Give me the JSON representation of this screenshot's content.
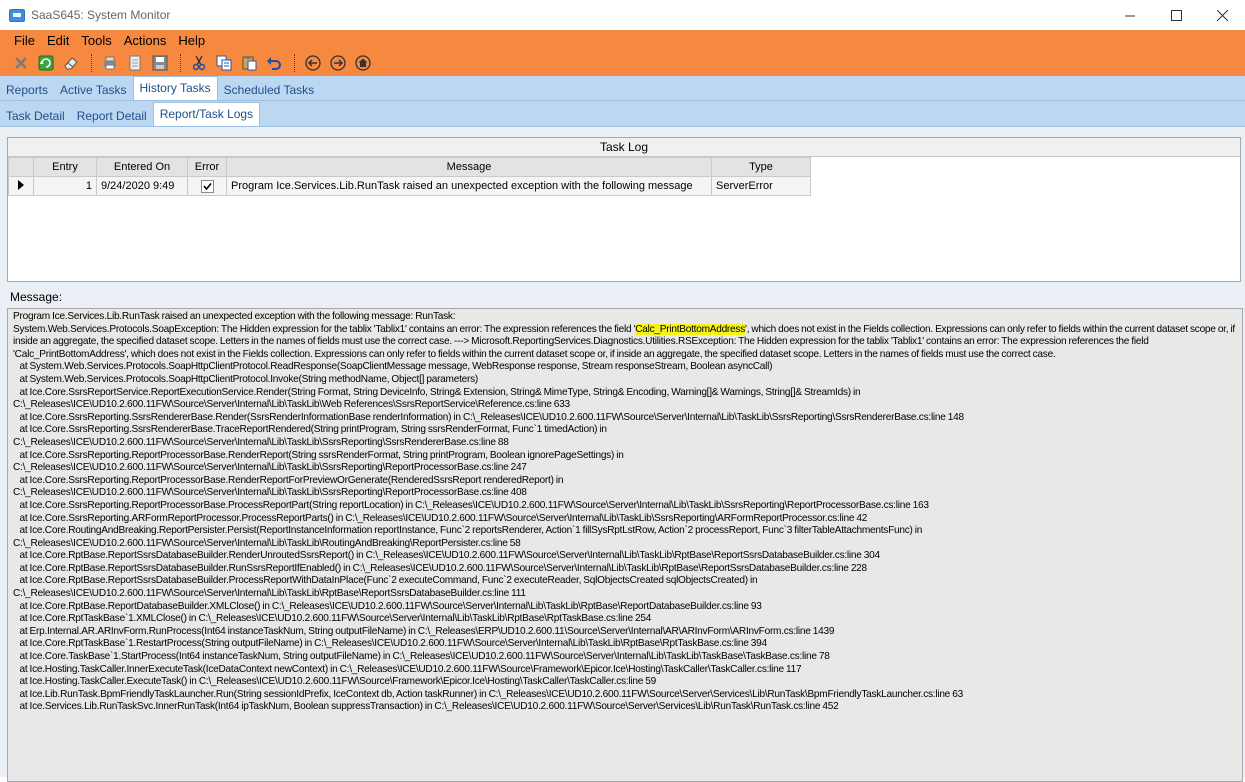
{
  "window": {
    "title": "SaaS645: System Monitor"
  },
  "menu": [
    "File",
    "Edit",
    "Tools",
    "Actions",
    "Help"
  ],
  "tabs_primary": [
    {
      "label": "Reports",
      "active": false
    },
    {
      "label": "Active Tasks",
      "active": false
    },
    {
      "label": "History Tasks",
      "active": true
    },
    {
      "label": "Scheduled Tasks",
      "active": false
    }
  ],
  "tabs_secondary": [
    {
      "label": "Task Detail",
      "active": false
    },
    {
      "label": "Report Detail",
      "active": false
    },
    {
      "label": "Report/Task Logs",
      "active": true
    }
  ],
  "task_log": {
    "title": "Task Log",
    "columns": [
      "Entry",
      "Entered On",
      "Error",
      "Message",
      "Type"
    ],
    "rows": [
      {
        "entry": "1",
        "entered_on": "9/24/2020 9:49",
        "error": true,
        "message": "Program Ice.Services.Lib.RunTask raised an unexpected exception with the following message",
        "type": "ServerError"
      }
    ]
  },
  "message_panel": {
    "label": "Message:",
    "text_before": "Program Ice.Services.Lib.RunTask raised an unexpected exception with the following message: RunTask:\nSystem.Web.Services.Protocols.SoapException: The Hidden expression for the tablix 'Tablix1' contains an error: The expression references the field '",
    "highlight": "Calc_PrintBottomAddress",
    "text_after": "', which does not exist in the Fields collection. Expressions can only refer to fields within the current dataset scope or, if inside an aggregate, the specified dataset scope. Letters in the names of fields must use the correct case. ---> Microsoft.ReportingServices.Diagnostics.Utilities.RSException: The Hidden expression for the tablix 'Tablix1' contains an error: The expression references the field 'Calc_PrintBottomAddress', which does not exist in the Fields collection. Expressions can only refer to fields within the current dataset scope or, if inside an aggregate, the specified dataset scope. Letters in the names of fields must use the correct case.\n   at System.Web.Services.Protocols.SoapHttpClientProtocol.ReadResponse(SoapClientMessage message, WebResponse response, Stream responseStream, Boolean asyncCall)\n   at System.Web.Services.Protocols.SoapHttpClientProtocol.Invoke(String methodName, Object[] parameters)\n   at Ice.Core.SsrsReportService.ReportExecutionService.Render(String Format, String DeviceInfo, String& Extension, String& MimeType, String& Encoding, Warning[]& Warnings, String[]& StreamIds) in\nC:\\_Releases\\ICE\\UD10.2.600.11FW\\Source\\Server\\Internal\\Lib\\TaskLib\\Web References\\SsrsReportService\\Reference.cs:line 633\n   at Ice.Core.SsrsReporting.SsrsRendererBase.Render(SsrsRenderInformationBase renderInformation) in C:\\_Releases\\ICE\\UD10.2.600.11FW\\Source\\Server\\Internal\\Lib\\TaskLib\\SsrsReporting\\SsrsRendererBase.cs:line 148\n   at Ice.Core.SsrsReporting.SsrsRendererBase.TraceReportRendered(String printProgram, String ssrsRenderFormat, Func`1 timedAction) in\nC:\\_Releases\\ICE\\UD10.2.600.11FW\\Source\\Server\\Internal\\Lib\\TaskLib\\SsrsReporting\\SsrsRendererBase.cs:line 88\n   at Ice.Core.SsrsReporting.ReportProcessorBase.RenderReport(String ssrsRenderFormat, String printProgram, Boolean ignorePageSettings) in\nC:\\_Releases\\ICE\\UD10.2.600.11FW\\Source\\Server\\Internal\\Lib\\TaskLib\\SsrsReporting\\ReportProcessorBase.cs:line 247\n   at Ice.Core.SsrsReporting.ReportProcessorBase.RenderReportForPreviewOrGenerate(RenderedSsrsReport renderedReport) in\nC:\\_Releases\\ICE\\UD10.2.600.11FW\\Source\\Server\\Internal\\Lib\\TaskLib\\SsrsReporting\\ReportProcessorBase.cs:line 408\n   at Ice.Core.SsrsReporting.ReportProcessorBase.ProcessReportPart(String reportLocation) in C:\\_Releases\\ICE\\UD10.2.600.11FW\\Source\\Server\\Internal\\Lib\\TaskLib\\SsrsReporting\\ReportProcessorBase.cs:line 163\n   at Ice.Core.SsrsReporting.ARFormReportProcessor.ProcessReportParts() in C:\\_Releases\\ICE\\UD10.2.600.11FW\\Source\\Server\\Internal\\Lib\\TaskLib\\SsrsReporting\\ARFormReportProcessor.cs:line 42\n   at Ice.Core.RoutingAndBreaking.ReportPersister.Persist(ReportInstanceInformation reportInstance, Func`2 reportsRenderer, Action`1 fillSysRptLstRow, Action`2 processReport, Func`3 filterTableAttachmentsFunc) in\nC:\\_Releases\\ICE\\UD10.2.600.11FW\\Source\\Server\\Internal\\Lib\\TaskLib\\RoutingAndBreaking\\ReportPersister.cs:line 58\n   at Ice.Core.RptBase.ReportSsrsDatabaseBuilder.RenderUnroutedSsrsReport() in C:\\_Releases\\ICE\\UD10.2.600.11FW\\Source\\Server\\Internal\\Lib\\TaskLib\\RptBase\\ReportSsrsDatabaseBuilder.cs:line 304\n   at Ice.Core.RptBase.ReportSsrsDatabaseBuilder.RunSsrsReportIfEnabled() in C:\\_Releases\\ICE\\UD10.2.600.11FW\\Source\\Server\\Internal\\Lib\\TaskLib\\RptBase\\ReportSsrsDatabaseBuilder.cs:line 228\n   at Ice.Core.RptBase.ReportSsrsDatabaseBuilder.ProcessReportWithDataInPlace(Func`2 executeCommand, Func`2 executeReader, SqlObjectsCreated sqlObjectsCreated) in\nC:\\_Releases\\ICE\\UD10.2.600.11FW\\Source\\Server\\Internal\\Lib\\TaskLib\\RptBase\\ReportSsrsDatabaseBuilder.cs:line 111\n   at Ice.Core.RptBase.ReportDatabaseBuilder.XMLClose() in C:\\_Releases\\ICE\\UD10.2.600.11FW\\Source\\Server\\Internal\\Lib\\TaskLib\\RptBase\\ReportDatabaseBuilder.cs:line 93\n   at Ice.Core.RptTaskBase`1.XMLClose() in C:\\_Releases\\ICE\\UD10.2.600.11FW\\Source\\Server\\Internal\\Lib\\TaskLib\\RptBase\\RptTaskBase.cs:line 254\n   at Erp.Internal.AR.ARInvForm.RunProcess(Int64 instanceTaskNum, String outputFileName) in C:\\_Releases\\ERP\\UD10.2.600.11\\Source\\Server\\Internal\\AR\\ARInvForm\\ARInvForm.cs:line 1439\n   at Ice.Core.RptTaskBase`1.RestartProcess(String outputFileName) in C:\\_Releases\\ICE\\UD10.2.600.11FW\\Source\\Server\\Internal\\Lib\\TaskLib\\RptBase\\RptTaskBase.cs:line 394\n   at Ice.Core.TaskBase`1.StartProcess(Int64 instanceTaskNum, String outputFileName) in C:\\_Releases\\ICE\\UD10.2.600.11FW\\Source\\Server\\Internal\\Lib\\TaskLib\\TaskBase\\TaskBase.cs:line 78\n   at Ice.Hosting.TaskCaller.InnerExecuteTask(IceDataContext newContext) in C:\\_Releases\\ICE\\UD10.2.600.11FW\\Source\\Framework\\Epicor.Ice\\Hosting\\TaskCaller\\TaskCaller.cs:line 117\n   at Ice.Hosting.TaskCaller.ExecuteTask() in C:\\_Releases\\ICE\\UD10.2.600.11FW\\Source\\Framework\\Epicor.Ice\\Hosting\\TaskCaller\\TaskCaller.cs:line 59\n   at Ice.Lib.RunTask.BpmFriendlyTaskLauncher.Run(String sessionIdPrefix, IceContext db, Action taskRunner) in C:\\_Releases\\ICE\\UD10.2.600.11FW\\Source\\Server\\Services\\Lib\\RunTask\\BpmFriendlyTaskLauncher.cs:line 63\n   at Ice.Services.Lib.RunTaskSvc.InnerRunTask(Int64 ipTaskNum, Boolean suppressTransaction) in C:\\_Releases\\ICE\\UD10.2.600.11FW\\Source\\Server\\Services\\Lib\\RunTask\\RunTask.cs:line 452"
  },
  "colors": {
    "menubar": "#f7883f",
    "tabs": "#bcd7f2",
    "highlight": "#f5f21a"
  }
}
